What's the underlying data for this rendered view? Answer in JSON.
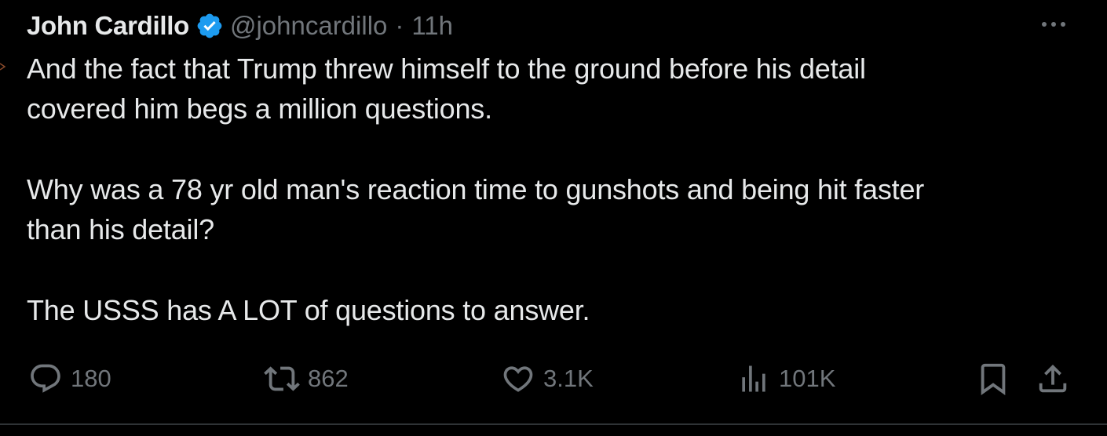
{
  "author": {
    "display_name": "John Cardillo",
    "handle": "@johncardillo",
    "separator": "·",
    "time": "11h",
    "verified_icon": "verified-badge-icon"
  },
  "tweet": {
    "paragraphs": [
      {
        "line1": "And the fact that Trump threw himself to the ground before his detail",
        "line2": "covered him begs a million questions."
      },
      {
        "line1": "Why was a 78 yr old man's reaction time to gunshots and being hit faster",
        "line2": "than his detail?"
      },
      {
        "line1": "The USSS has A LOT of questions to answer."
      }
    ]
  },
  "actions": {
    "reply": {
      "icon": "reply-icon",
      "count": "180"
    },
    "repost": {
      "icon": "repost-icon",
      "count": "862"
    },
    "like": {
      "icon": "heart-icon",
      "count": "3.1K"
    },
    "views": {
      "icon": "views-icon",
      "count": "101K"
    },
    "bookmark": {
      "icon": "bookmark-icon"
    },
    "share": {
      "icon": "share-icon"
    }
  },
  "colors": {
    "background": "#000000",
    "text_primary": "#e7e9ea",
    "text_secondary": "#71767b",
    "verified": "#1d9bf0",
    "divider": "#2f3336"
  }
}
